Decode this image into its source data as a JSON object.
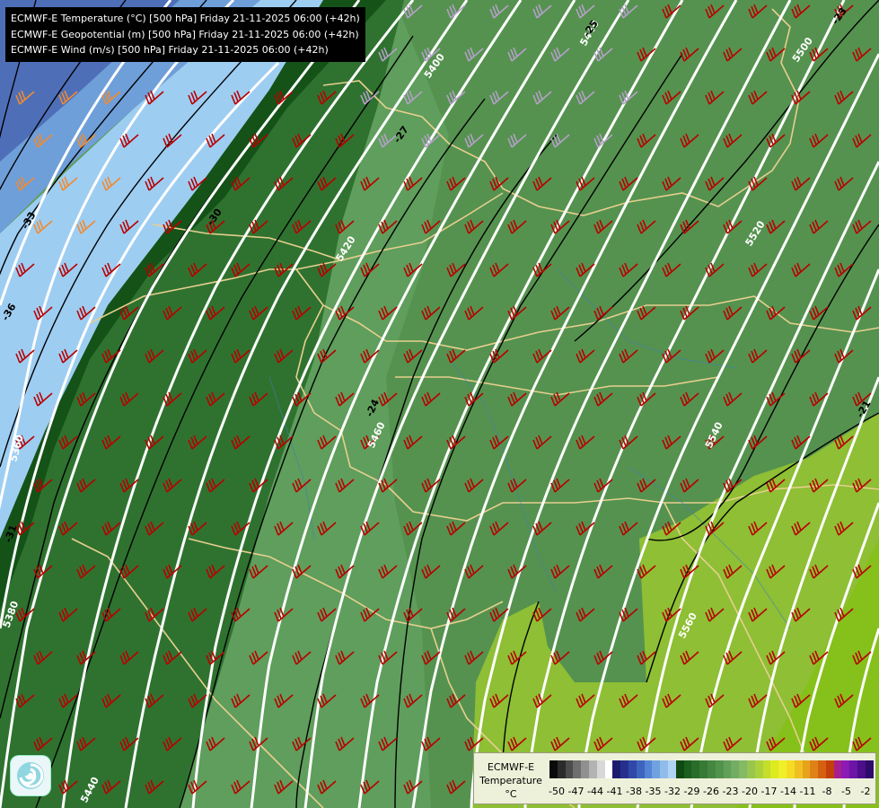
{
  "title_lines": [
    "ECMWF-E Temperature (°C) [500 hPa] Friday 21-11-2025 06:00 (+42h)",
    "ECMWF-E Geopotential (m) [500 hPa] Friday 21-11-2025 06:00 (+42h)",
    "ECMWF-E Wind (m/s) [500 hPa] Friday 21-11-2025 06:00 (+42h)"
  ],
  "legend": {
    "title_line1": "ECMWF-E",
    "title_line2": "Temperature",
    "unit": "°C",
    "ticks": [
      "-50",
      "-47",
      "-44",
      "-41",
      "-38",
      "-35",
      "-32",
      "-29",
      "-26",
      "-23",
      "-20",
      "-17",
      "-14",
      "-11",
      "-8",
      "-5",
      "-2"
    ],
    "colors": [
      "#0a0a0a",
      "#2b2b2b",
      "#4c4c4c",
      "#6e6e6e",
      "#909090",
      "#b3b3b3",
      "#d8d8d8",
      "#ffffff",
      "#1c1c6e",
      "#26308c",
      "#3048a8",
      "#3e64c0",
      "#5484d4",
      "#70a2e0",
      "#90bcec",
      "#b2d4f4",
      "#0f4a13",
      "#1d5f1e",
      "#2a6d2a",
      "#377a36",
      "#458740",
      "#52934b",
      "#62a05a",
      "#72ad64",
      "#84b966",
      "#98c54e",
      "#acd23a",
      "#c4de2a",
      "#dcea20",
      "#f0f028",
      "#f4dc24",
      "#f0c020",
      "#e8a21c",
      "#de8216",
      "#d46010",
      "#c4400a",
      "#a81e8c",
      "#8c1ab4",
      "#6c14a6",
      "#4c0e8a",
      "#2e0a6a"
    ]
  },
  "contour_labels": {
    "geopotential": [
      "5440",
      "5400",
      "5500",
      "5420",
      "5520",
      "5460",
      "5540",
      "5360",
      "5380",
      "5560",
      "5440"
    ],
    "temperature": [
      "-23",
      "-25",
      "-27",
      "-30",
      "-33",
      "-36",
      "-24",
      "-21",
      "-31"
    ]
  },
  "icons": {
    "logo": "swirl-logo-icon",
    "wind": "wind-barb-icon"
  },
  "colors": {
    "isohypse": "#ffffff",
    "isotherm": "#000000",
    "border": "#e7cf8f",
    "barb_strong": "#b80000",
    "barb_light": "#b4a0c8"
  }
}
